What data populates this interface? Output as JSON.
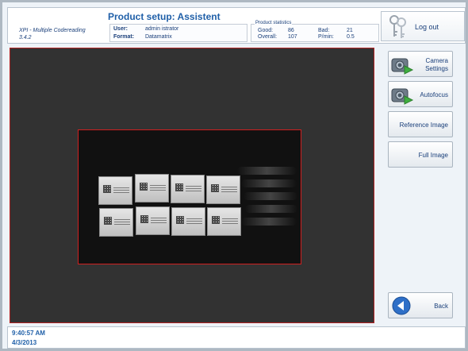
{
  "app": {
    "name": "XPI - Multiple Codereading",
    "version": "3.4.2"
  },
  "header": {
    "title": "Product setup: Assistent",
    "user_label": "User:",
    "user_value": "admin istrator",
    "format_label": "Format:",
    "format_value": "Datamatrix"
  },
  "stats": {
    "title": "Product statistics",
    "good_label": "Good:",
    "good_value": "86",
    "bad_label": "Bad:",
    "bad_value": "21",
    "overall_label": "Overall:",
    "overall_value": "107",
    "ppmin_label": "P/min:",
    "ppmin_value": "0.5"
  },
  "logout": {
    "label": "Log out",
    "icon": "keys-icon"
  },
  "side_buttons": {
    "camera_settings": "Camera Settings",
    "autofocus": "Autofocus",
    "reference_image": "Reference Image",
    "full_image": "Full Image",
    "back": "Back"
  },
  "footer": {
    "time": "9:40:57 AM",
    "date": "4/3/2013"
  },
  "colors": {
    "accent": "#1f5fa8",
    "roi_border": "#d02020",
    "view_background": "#323232"
  }
}
